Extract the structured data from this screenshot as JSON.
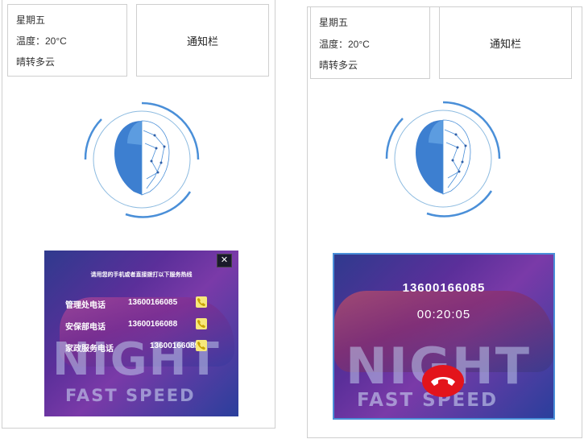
{
  "left": {
    "weather": {
      "day": "星期五",
      "temperature": "温度：20°C",
      "condition": "晴转多云"
    },
    "notice": "通知栏",
    "hotline": {
      "title": "请用您的手机或者直接拨打以下服务热线",
      "entries": [
        {
          "name": "管理处电话",
          "number": "13600166085"
        },
        {
          "name": "安保部电话",
          "number": "13600166088"
        },
        {
          "name": "家政服务电话",
          "number": "13600166089"
        }
      ]
    },
    "poster": {
      "headline": "NIGHT",
      "subline": "FAST SPEED"
    }
  },
  "right": {
    "weather": {
      "day": "星期五",
      "temperature": "温度：20°C",
      "condition": "晴转多云"
    },
    "notice": "通知栏",
    "call": {
      "number": "13600166085",
      "duration": "00:20:05"
    },
    "poster": {
      "headline": "NIGHT",
      "subline": "FAST SPEED"
    }
  },
  "icons": {
    "face": "face-scan-icon",
    "phone": "phone-icon",
    "hangup": "hang-up-icon",
    "close": "close-icon"
  },
  "colors": {
    "accent_blue": "#4a8fd8",
    "hangup_red": "#e3141b",
    "call_button_yellow": "#f7e87a"
  }
}
